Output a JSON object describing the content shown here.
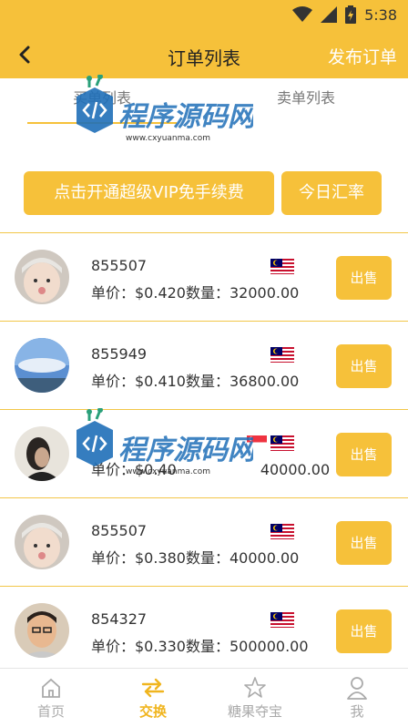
{
  "status_bar": {
    "time": "5:38"
  },
  "header": {
    "title": "订单列表",
    "publish_label": "发布订单"
  },
  "tabs": [
    {
      "label": "买单列表"
    },
    {
      "label": "卖单列表"
    }
  ],
  "actions": {
    "vip_label": "点击开通超级VIP免手续费",
    "rate_label": "今日汇率"
  },
  "orders": [
    {
      "id": "855507",
      "price_text": "单价：$0.420数量：32000.00",
      "sell_label": "出售",
      "flags": [
        "malaysia-flag"
      ]
    },
    {
      "id": "855949",
      "price_text": "单价：$0.410数量：36800.00",
      "sell_label": "出售",
      "flags": [
        "malaysia-flag"
      ]
    },
    {
      "id": "",
      "price_text": "单价：$0.40",
      "price_tail": "40000.00",
      "sell_label": "出售",
      "flags": [
        "singapore-flag",
        "malaysia-flag"
      ]
    },
    {
      "id": "855507",
      "price_text": "单价：$0.380数量：40000.00",
      "sell_label": "出售",
      "flags": [
        "malaysia-flag"
      ]
    },
    {
      "id": "854327",
      "price_text": "单价：$0.330数量：500000.00",
      "sell_label": "出售",
      "flags": [
        "malaysia-flag"
      ]
    }
  ],
  "bottom_nav": [
    {
      "label": "首页",
      "icon": "home-icon"
    },
    {
      "label": "交换",
      "icon": "exchange-icon"
    },
    {
      "label": "糖果夺宝",
      "icon": "star-icon"
    },
    {
      "label": "我",
      "icon": "user-icon"
    }
  ],
  "watermark": {
    "text": "程序源码网",
    "url": "www.cxyuanma.com"
  },
  "colors": {
    "accent": "#f6c13a",
    "active_nav": "#f0b51f",
    "divider": "#f2c648"
  }
}
